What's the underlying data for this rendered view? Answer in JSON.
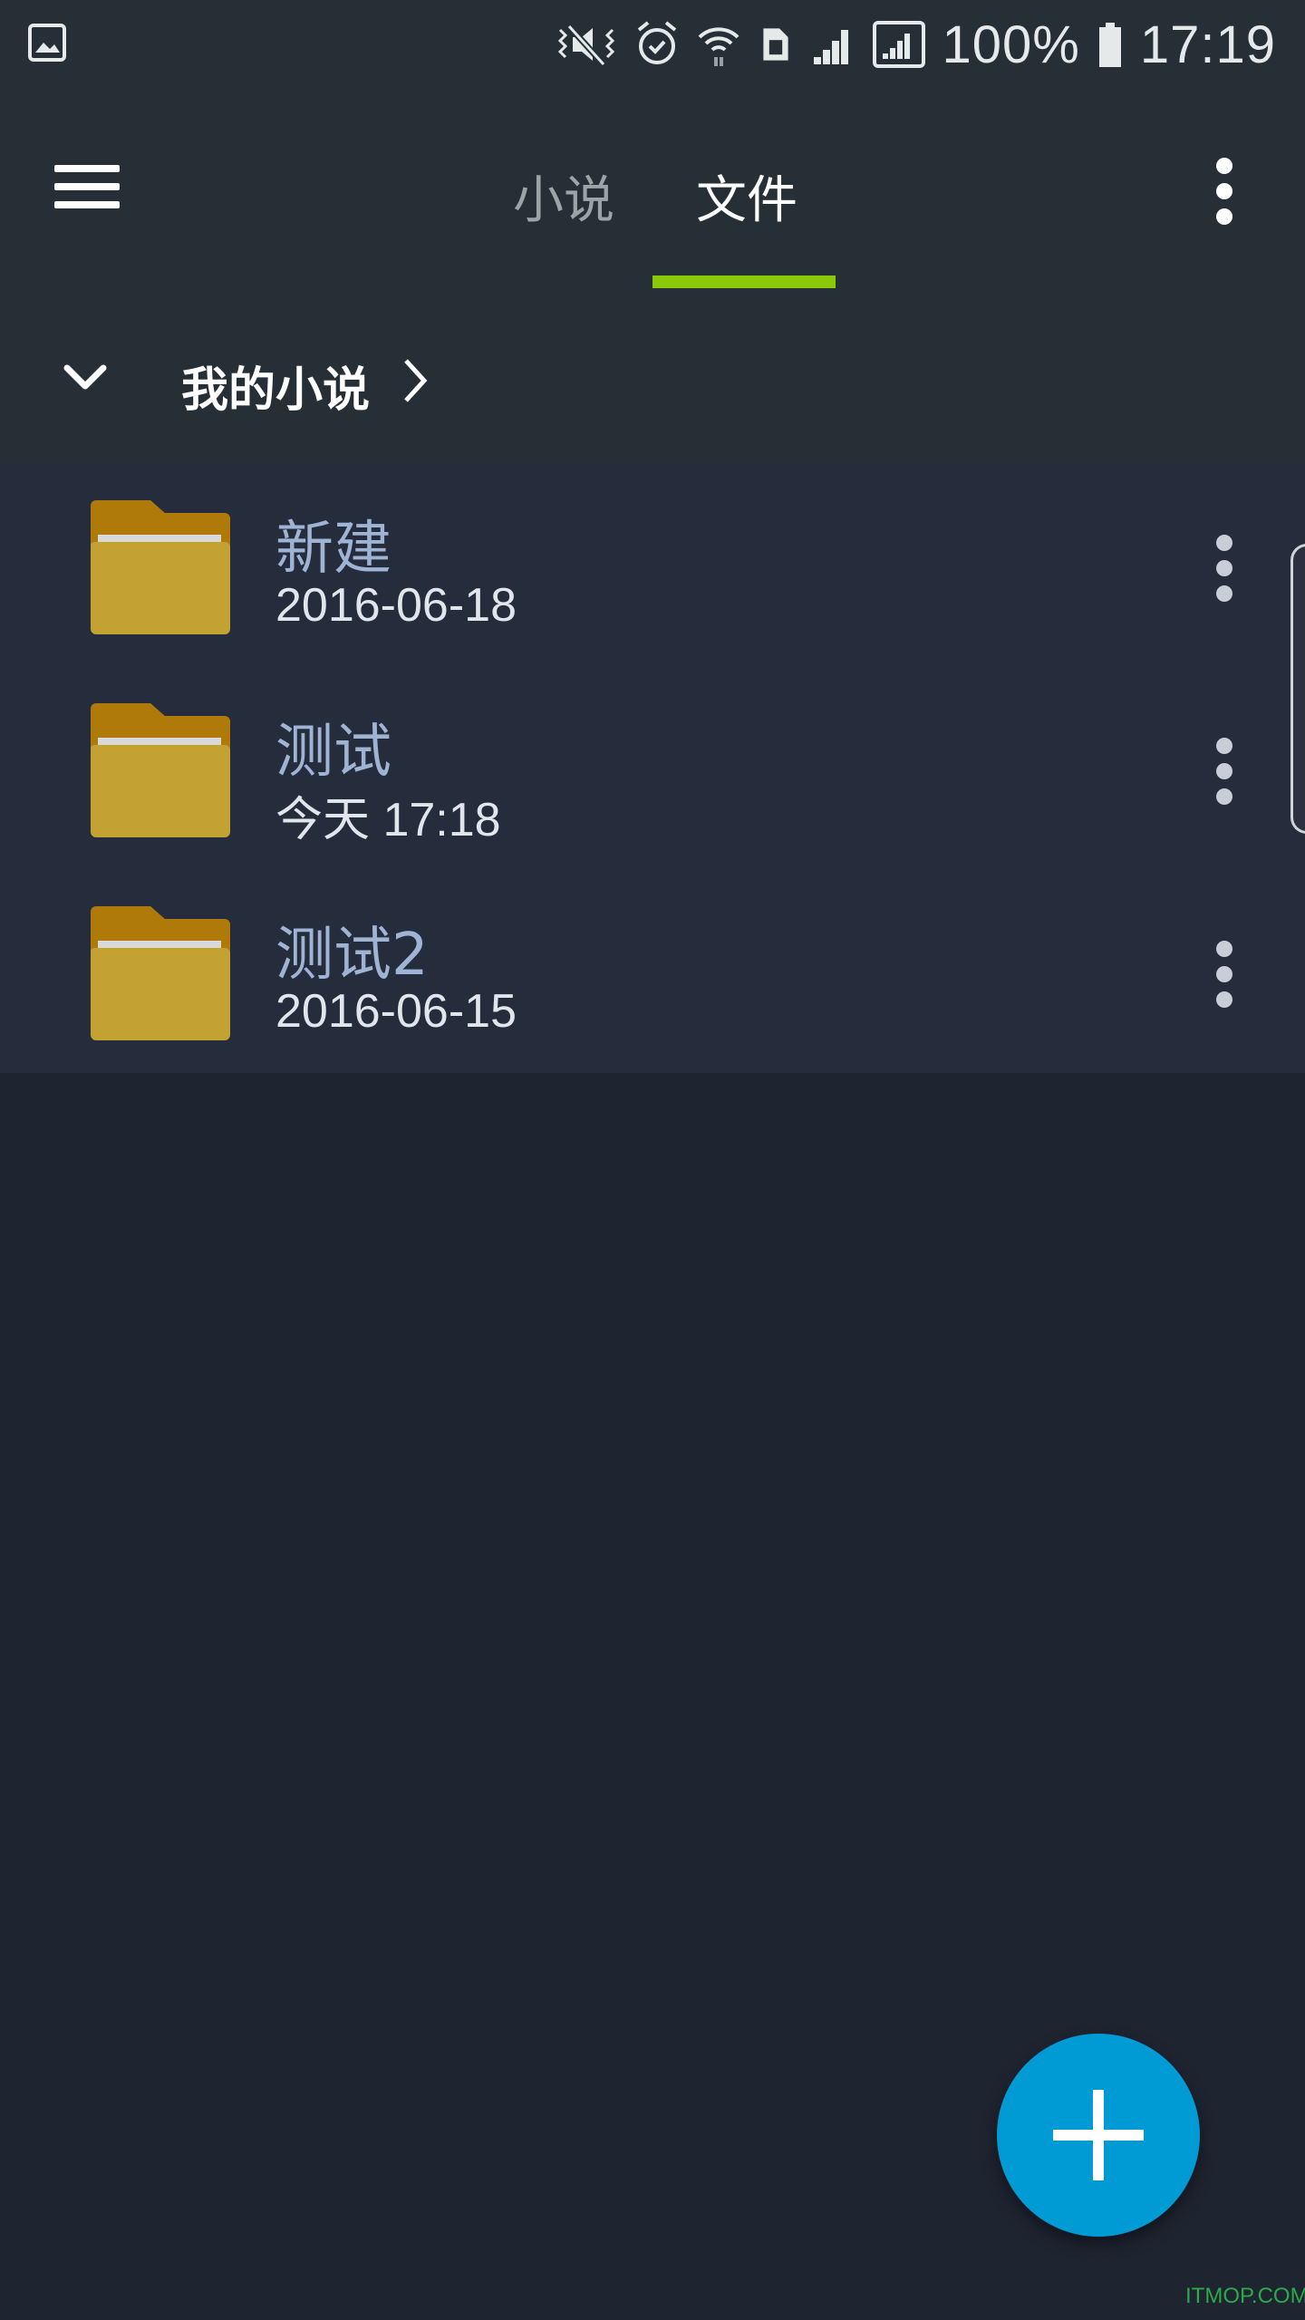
{
  "status_bar": {
    "battery_percent": "100%",
    "time": "17:19",
    "icons": [
      "gallery-notification-icon",
      "vibrate-mute-icon",
      "alarm-icon",
      "wifi-icon",
      "sim-icon",
      "signal-icon",
      "signal-boxed-icon",
      "battery-icon"
    ]
  },
  "app_bar": {
    "tabs": [
      {
        "label": "小说",
        "selected": false
      },
      {
        "label": "文件",
        "selected": true
      }
    ],
    "accent_color": "#8ac80a"
  },
  "breadcrumb": {
    "title": "我的小说"
  },
  "files": [
    {
      "name": "新建",
      "date": "2016-06-18"
    },
    {
      "name": "测试",
      "date": "今天 17:18"
    },
    {
      "name": "测试2",
      "date": "2016-06-15"
    }
  ],
  "fab": {
    "icon": "plus-icon",
    "color": "#009ad4"
  },
  "watermark": "ITMOP.COM"
}
